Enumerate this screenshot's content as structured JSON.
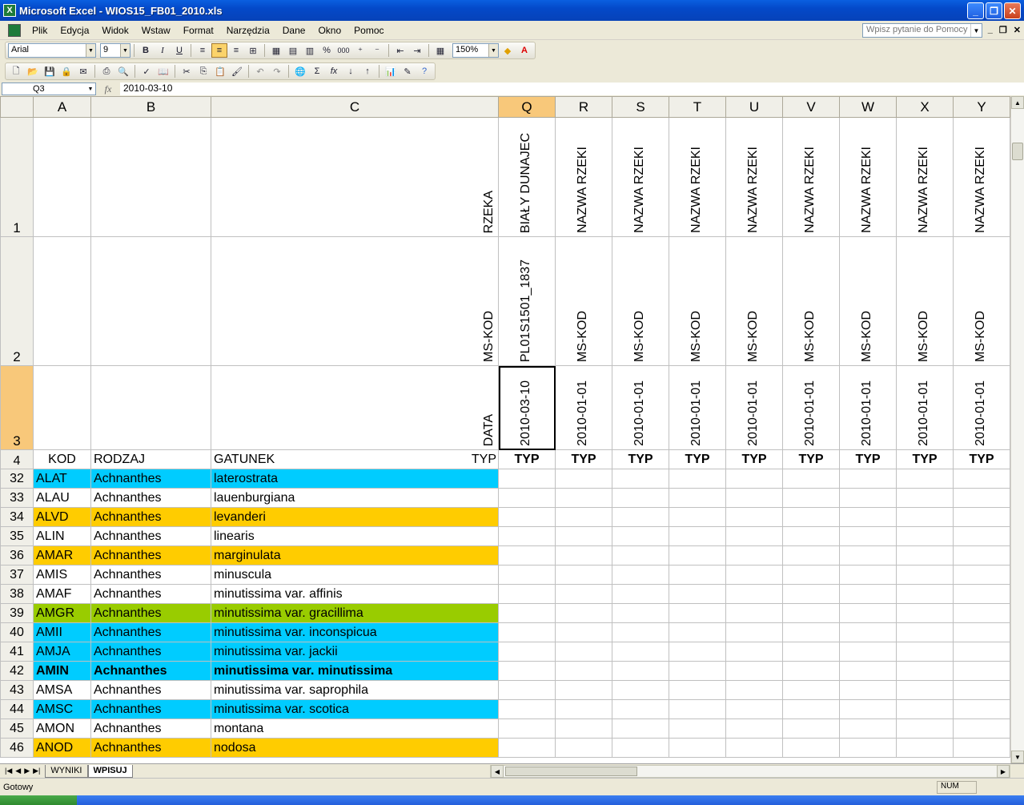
{
  "window": {
    "title": "Microsoft Excel - WIOS15_FB01_2010.xls"
  },
  "menu": [
    "Plik",
    "Edycja",
    "Widok",
    "Wstaw",
    "Format",
    "Narzędzia",
    "Dane",
    "Okno",
    "Pomoc"
  ],
  "help_placeholder": "Wpisz pytanie do Pomocy",
  "format_toolbar": {
    "font": "Arial",
    "size": "9",
    "zoom": "150%"
  },
  "formula_bar": {
    "name_box": "Q3",
    "value": "2010-03-10"
  },
  "columns": [
    "A",
    "B",
    "C",
    "Q",
    "R",
    "S",
    "T",
    "U",
    "V",
    "W",
    "X",
    "Y"
  ],
  "header_rows": {
    "row1": {
      "num": "1",
      "label": "RZEKA",
      "values": [
        "BIAŁY DUNAJEC",
        "NAZWA RZEKI",
        "NAZWA RZEKI",
        "NAZWA RZEKI",
        "NAZWA RZEKI",
        "NAZWA RZEKI",
        "NAZWA RZEKI",
        "NAZWA RZEKI",
        "NAZWA RZEKI"
      ]
    },
    "row2": {
      "num": "2",
      "label": "MS-KOD",
      "values": [
        "PL01S1501_1837",
        "MS-KOD",
        "MS-KOD",
        "MS-KOD",
        "MS-KOD",
        "MS-KOD",
        "MS-KOD",
        "MS-KOD",
        "MS-KOD"
      ]
    },
    "row3": {
      "num": "3",
      "label": "DATA",
      "values": [
        "2010-03-10",
        "2010-01-01",
        "2010-01-01",
        "2010-01-01",
        "2010-01-01",
        "2010-01-01",
        "2010-01-01",
        "2010-01-01",
        "2010-01-01"
      ]
    },
    "row4": {
      "num": "4",
      "kod": "KOD",
      "rodzaj": "RODZAJ",
      "gatunek": "GATUNEK",
      "typ_label": "TYP",
      "typ": [
        "TYP",
        "TYP",
        "TYP",
        "TYP",
        "TYP",
        "TYP",
        "TYP",
        "TYP",
        "TYP"
      ]
    }
  },
  "rows": [
    {
      "num": "32",
      "kod": "ALAT",
      "rodzaj": "Achnanthes",
      "gatunek": "laterostrata",
      "color": "#00ccff",
      "bold": false
    },
    {
      "num": "33",
      "kod": "ALAU",
      "rodzaj": "Achnanthes",
      "gatunek": "lauenburgiana",
      "color": "#ffffff",
      "bold": false
    },
    {
      "num": "34",
      "kod": "ALVD",
      "rodzaj": "Achnanthes",
      "gatunek": "levanderi",
      "color": "#ffcc00",
      "bold": false
    },
    {
      "num": "35",
      "kod": "ALIN",
      "rodzaj": "Achnanthes",
      "gatunek": "linearis",
      "color": "#ffffff",
      "bold": false
    },
    {
      "num": "36",
      "kod": "AMAR",
      "rodzaj": "Achnanthes",
      "gatunek": "marginulata",
      "color": "#ffcc00",
      "bold": false
    },
    {
      "num": "37",
      "kod": "AMIS",
      "rodzaj": "Achnanthes",
      "gatunek": "minuscula",
      "color": "#ffffff",
      "bold": false
    },
    {
      "num": "38",
      "kod": "AMAF",
      "rodzaj": "Achnanthes",
      "gatunek": "minutissima var. affinis",
      "color": "#ffffff",
      "bold": false
    },
    {
      "num": "39",
      "kod": "AMGR",
      "rodzaj": "Achnanthes",
      "gatunek": "minutissima var. gracillima",
      "color": "#99cc00",
      "bold": false
    },
    {
      "num": "40",
      "kod": "AMII",
      "rodzaj": "Achnanthes",
      "gatunek": "minutissima var. inconspicua",
      "color": "#00ccff",
      "bold": false
    },
    {
      "num": "41",
      "kod": "AMJA",
      "rodzaj": "Achnanthes",
      "gatunek": "minutissima var. jackii",
      "color": "#00ccff",
      "bold": false
    },
    {
      "num": "42",
      "kod": "AMIN",
      "rodzaj": "Achnanthes",
      "gatunek": "minutissima var. minutissima",
      "color": "#00ccff",
      "bold": true
    },
    {
      "num": "43",
      "kod": "AMSA",
      "rodzaj": "Achnanthes",
      "gatunek": "minutissima var. saprophila",
      "color": "#ffffff",
      "bold": false
    },
    {
      "num": "44",
      "kod": "AMSC",
      "rodzaj": "Achnanthes",
      "gatunek": "minutissima var. scotica",
      "color": "#00ccff",
      "bold": false
    },
    {
      "num": "45",
      "kod": "AMON",
      "rodzaj": "Achnanthes",
      "gatunek": "montana",
      "color": "#ffffff",
      "bold": false
    },
    {
      "num": "46",
      "kod": "ANOD",
      "rodzaj": "Achnanthes",
      "gatunek": "nodosa",
      "color": "#ffcc00",
      "bold": false
    }
  ],
  "sheet_tabs": [
    "WYNIKI",
    "WPISUJ"
  ],
  "status": {
    "left": "Gotowy",
    "num": "NUM"
  }
}
